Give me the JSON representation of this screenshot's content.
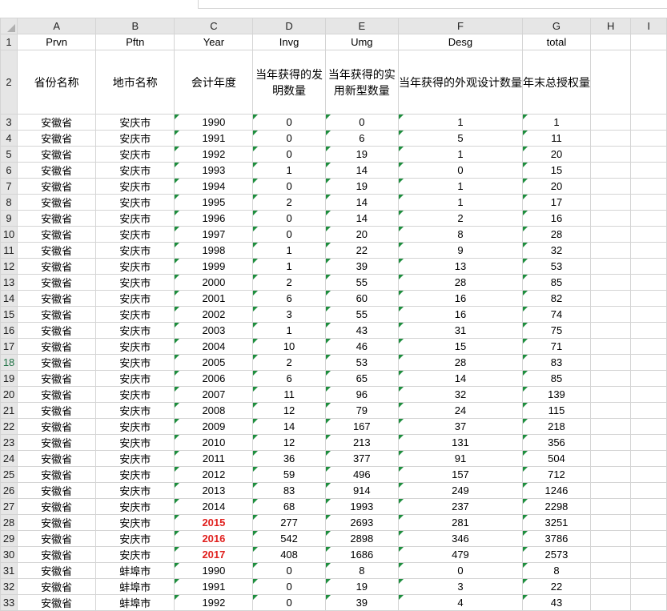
{
  "columns": [
    "A",
    "B",
    "C",
    "D",
    "E",
    "F",
    "G",
    "H",
    "I"
  ],
  "rows": [
    {
      "num": "1",
      "cells": [
        "Prvn",
        "Pftn",
        "Year",
        "Invg",
        "Umg",
        "Desg",
        "total",
        "",
        ""
      ]
    },
    {
      "num": "2",
      "cells": [
        "省份名称",
        "地市名称",
        "会计年度",
        "当年获得的发明数量",
        "当年获得的实用新型数量",
        "当年获得的外观设计数量",
        "年末总授权量",
        "",
        ""
      ]
    },
    {
      "num": "3",
      "cells": [
        "安徽省",
        "安庆市",
        "1990",
        "0",
        "0",
        "1",
        "1",
        "",
        ""
      ]
    },
    {
      "num": "4",
      "cells": [
        "安徽省",
        "安庆市",
        "1991",
        "0",
        "6",
        "5",
        "11",
        "",
        ""
      ]
    },
    {
      "num": "5",
      "cells": [
        "安徽省",
        "安庆市",
        "1992",
        "0",
        "19",
        "1",
        "20",
        "",
        ""
      ]
    },
    {
      "num": "6",
      "cells": [
        "安徽省",
        "安庆市",
        "1993",
        "1",
        "14",
        "0",
        "15",
        "",
        ""
      ]
    },
    {
      "num": "7",
      "cells": [
        "安徽省",
        "安庆市",
        "1994",
        "0",
        "19",
        "1",
        "20",
        "",
        ""
      ]
    },
    {
      "num": "8",
      "cells": [
        "安徽省",
        "安庆市",
        "1995",
        "2",
        "14",
        "1",
        "17",
        "",
        ""
      ]
    },
    {
      "num": "9",
      "cells": [
        "安徽省",
        "安庆市",
        "1996",
        "0",
        "14",
        "2",
        "16",
        "",
        ""
      ]
    },
    {
      "num": "10",
      "cells": [
        "安徽省",
        "安庆市",
        "1997",
        "0",
        "20",
        "8",
        "28",
        "",
        ""
      ]
    },
    {
      "num": "11",
      "cells": [
        "安徽省",
        "安庆市",
        "1998",
        "1",
        "22",
        "9",
        "32",
        "",
        ""
      ]
    },
    {
      "num": "12",
      "cells": [
        "安徽省",
        "安庆市",
        "1999",
        "1",
        "39",
        "13",
        "53",
        "",
        ""
      ]
    },
    {
      "num": "13",
      "cells": [
        "安徽省",
        "安庆市",
        "2000",
        "2",
        "55",
        "28",
        "85",
        "",
        ""
      ]
    },
    {
      "num": "14",
      "cells": [
        "安徽省",
        "安庆市",
        "2001",
        "6",
        "60",
        "16",
        "82",
        "",
        ""
      ]
    },
    {
      "num": "15",
      "cells": [
        "安徽省",
        "安庆市",
        "2002",
        "3",
        "55",
        "16",
        "74",
        "",
        ""
      ]
    },
    {
      "num": "16",
      "cells": [
        "安徽省",
        "安庆市",
        "2003",
        "1",
        "43",
        "31",
        "75",
        "",
        ""
      ]
    },
    {
      "num": "17",
      "cells": [
        "安徽省",
        "安庆市",
        "2004",
        "10",
        "46",
        "15",
        "71",
        "",
        ""
      ]
    },
    {
      "num": "18",
      "cells": [
        "安徽省",
        "安庆市",
        "2005",
        "2",
        "53",
        "28",
        "83",
        "",
        ""
      ]
    },
    {
      "num": "19",
      "cells": [
        "安徽省",
        "安庆市",
        "2006",
        "6",
        "65",
        "14",
        "85",
        "",
        ""
      ]
    },
    {
      "num": "20",
      "cells": [
        "安徽省",
        "安庆市",
        "2007",
        "11",
        "96",
        "32",
        "139",
        "",
        ""
      ]
    },
    {
      "num": "21",
      "cells": [
        "安徽省",
        "安庆市",
        "2008",
        "12",
        "79",
        "24",
        "115",
        "",
        ""
      ]
    },
    {
      "num": "22",
      "cells": [
        "安徽省",
        "安庆市",
        "2009",
        "14",
        "167",
        "37",
        "218",
        "",
        ""
      ]
    },
    {
      "num": "23",
      "cells": [
        "安徽省",
        "安庆市",
        "2010",
        "12",
        "213",
        "131",
        "356",
        "",
        ""
      ]
    },
    {
      "num": "24",
      "cells": [
        "安徽省",
        "安庆市",
        "2011",
        "36",
        "377",
        "91",
        "504",
        "",
        ""
      ]
    },
    {
      "num": "25",
      "cells": [
        "安徽省",
        "安庆市",
        "2012",
        "59",
        "496",
        "157",
        "712",
        "",
        ""
      ]
    },
    {
      "num": "26",
      "cells": [
        "安徽省",
        "安庆市",
        "2013",
        "83",
        "914",
        "249",
        "1246",
        "",
        ""
      ]
    },
    {
      "num": "27",
      "cells": [
        "安徽省",
        "安庆市",
        "2014",
        "68",
        "1993",
        "237",
        "2298",
        "",
        ""
      ]
    },
    {
      "num": "28",
      "cells": [
        "安徽省",
        "安庆市",
        "2015",
        "277",
        "2693",
        "281",
        "3251",
        "",
        ""
      ]
    },
    {
      "num": "29",
      "cells": [
        "安徽省",
        "安庆市",
        "2016",
        "542",
        "2898",
        "346",
        "3786",
        "",
        ""
      ]
    },
    {
      "num": "30",
      "cells": [
        "安徽省",
        "安庆市",
        "2017",
        "408",
        "1686",
        "479",
        "2573",
        "",
        ""
      ]
    },
    {
      "num": "31",
      "cells": [
        "安徽省",
        "蚌埠市",
        "1990",
        "0",
        "8",
        "0",
        "8",
        "",
        ""
      ]
    },
    {
      "num": "32",
      "cells": [
        "安徽省",
        "蚌埠市",
        "1991",
        "0",
        "19",
        "3",
        "22",
        "",
        ""
      ]
    },
    {
      "num": "33",
      "cells": [
        "安徽省",
        "蚌埠市",
        "1992",
        "0",
        "39",
        "4",
        "43",
        "",
        ""
      ]
    }
  ],
  "active_row": "18",
  "highlight_years": [
    "2015",
    "2016",
    "2017"
  ],
  "colors": {
    "header_bg": "#e6e6e6",
    "active_row_header": "#217346",
    "highlight_text": "#e0201e",
    "text_flag": "#1e8e3e"
  }
}
